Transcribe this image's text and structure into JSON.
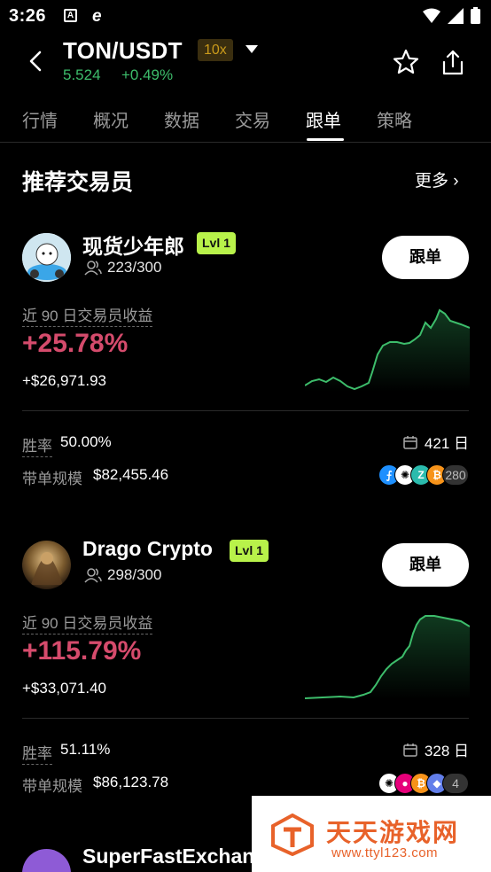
{
  "status": {
    "time": "3:26",
    "icon_a": "A",
    "icon_e": "e"
  },
  "header": {
    "pair": "TON/USDT",
    "leverage": "10x",
    "price": "5.524",
    "change": "+0.49%"
  },
  "tabs": [
    {
      "label": "行情"
    },
    {
      "label": "概况"
    },
    {
      "label": "数据"
    },
    {
      "label": "交易"
    },
    {
      "label": "跟单"
    },
    {
      "label": "策略"
    }
  ],
  "active_tab": "跟单",
  "section": {
    "title": "推荐交易员",
    "more": "更多 ›"
  },
  "traders": [
    {
      "name": "现货少年郎",
      "level": "Lvl 1",
      "followers": "223/300",
      "follow_label": "跟单",
      "earn_label": "近 90 日交易员收益",
      "earn_pct": "+25.78%",
      "earn_usd": "+$26,971.93",
      "win_rate_label": "胜率",
      "win_rate": "50.00%",
      "days": "421 日",
      "aum_label": "带单规模",
      "aum": "$82,455.46",
      "coin_count": "280",
      "coins": [
        {
          "name": "filecoin",
          "symbol": "⨍",
          "color": "#1e90ff"
        },
        {
          "name": "cardano",
          "symbol": "✺",
          "color": "#ffffff"
        },
        {
          "name": "zilliqa",
          "symbol": "Z",
          "color": "#2bbbad"
        },
        {
          "name": "bitcoin",
          "symbol": "₿",
          "color": "#f7931a"
        }
      ]
    },
    {
      "name": "Drago Crypto",
      "level": "Lvl 1",
      "followers": "298/300",
      "follow_label": "跟单",
      "earn_label": "近 90 日交易员收益",
      "earn_pct": "+115.79%",
      "earn_usd": "+$33,071.40",
      "win_rate_label": "胜率",
      "win_rate": "51.11%",
      "days": "328 日",
      "aum_label": "带单规模",
      "aum": "$86,123.78",
      "coin_count": "4",
      "coins": [
        {
          "name": "cardano",
          "symbol": "✺",
          "color": "#ffffff"
        },
        {
          "name": "polkadot",
          "symbol": "●",
          "color": "#e6007a"
        },
        {
          "name": "bitcoin",
          "symbol": "₿",
          "color": "#f7931a"
        },
        {
          "name": "ethereum",
          "symbol": "◆",
          "color": "#627eea"
        }
      ]
    }
  ],
  "third_trader": {
    "name": "SuperFastExchange"
  },
  "watermark": {
    "title": "天天游戏网",
    "url": "www.ttyl123.com"
  },
  "colors": {
    "positive": "#3dbd6b",
    "profit": "#d54b6c",
    "level": "#b8f24a",
    "leverage": "#c99a1b"
  }
}
